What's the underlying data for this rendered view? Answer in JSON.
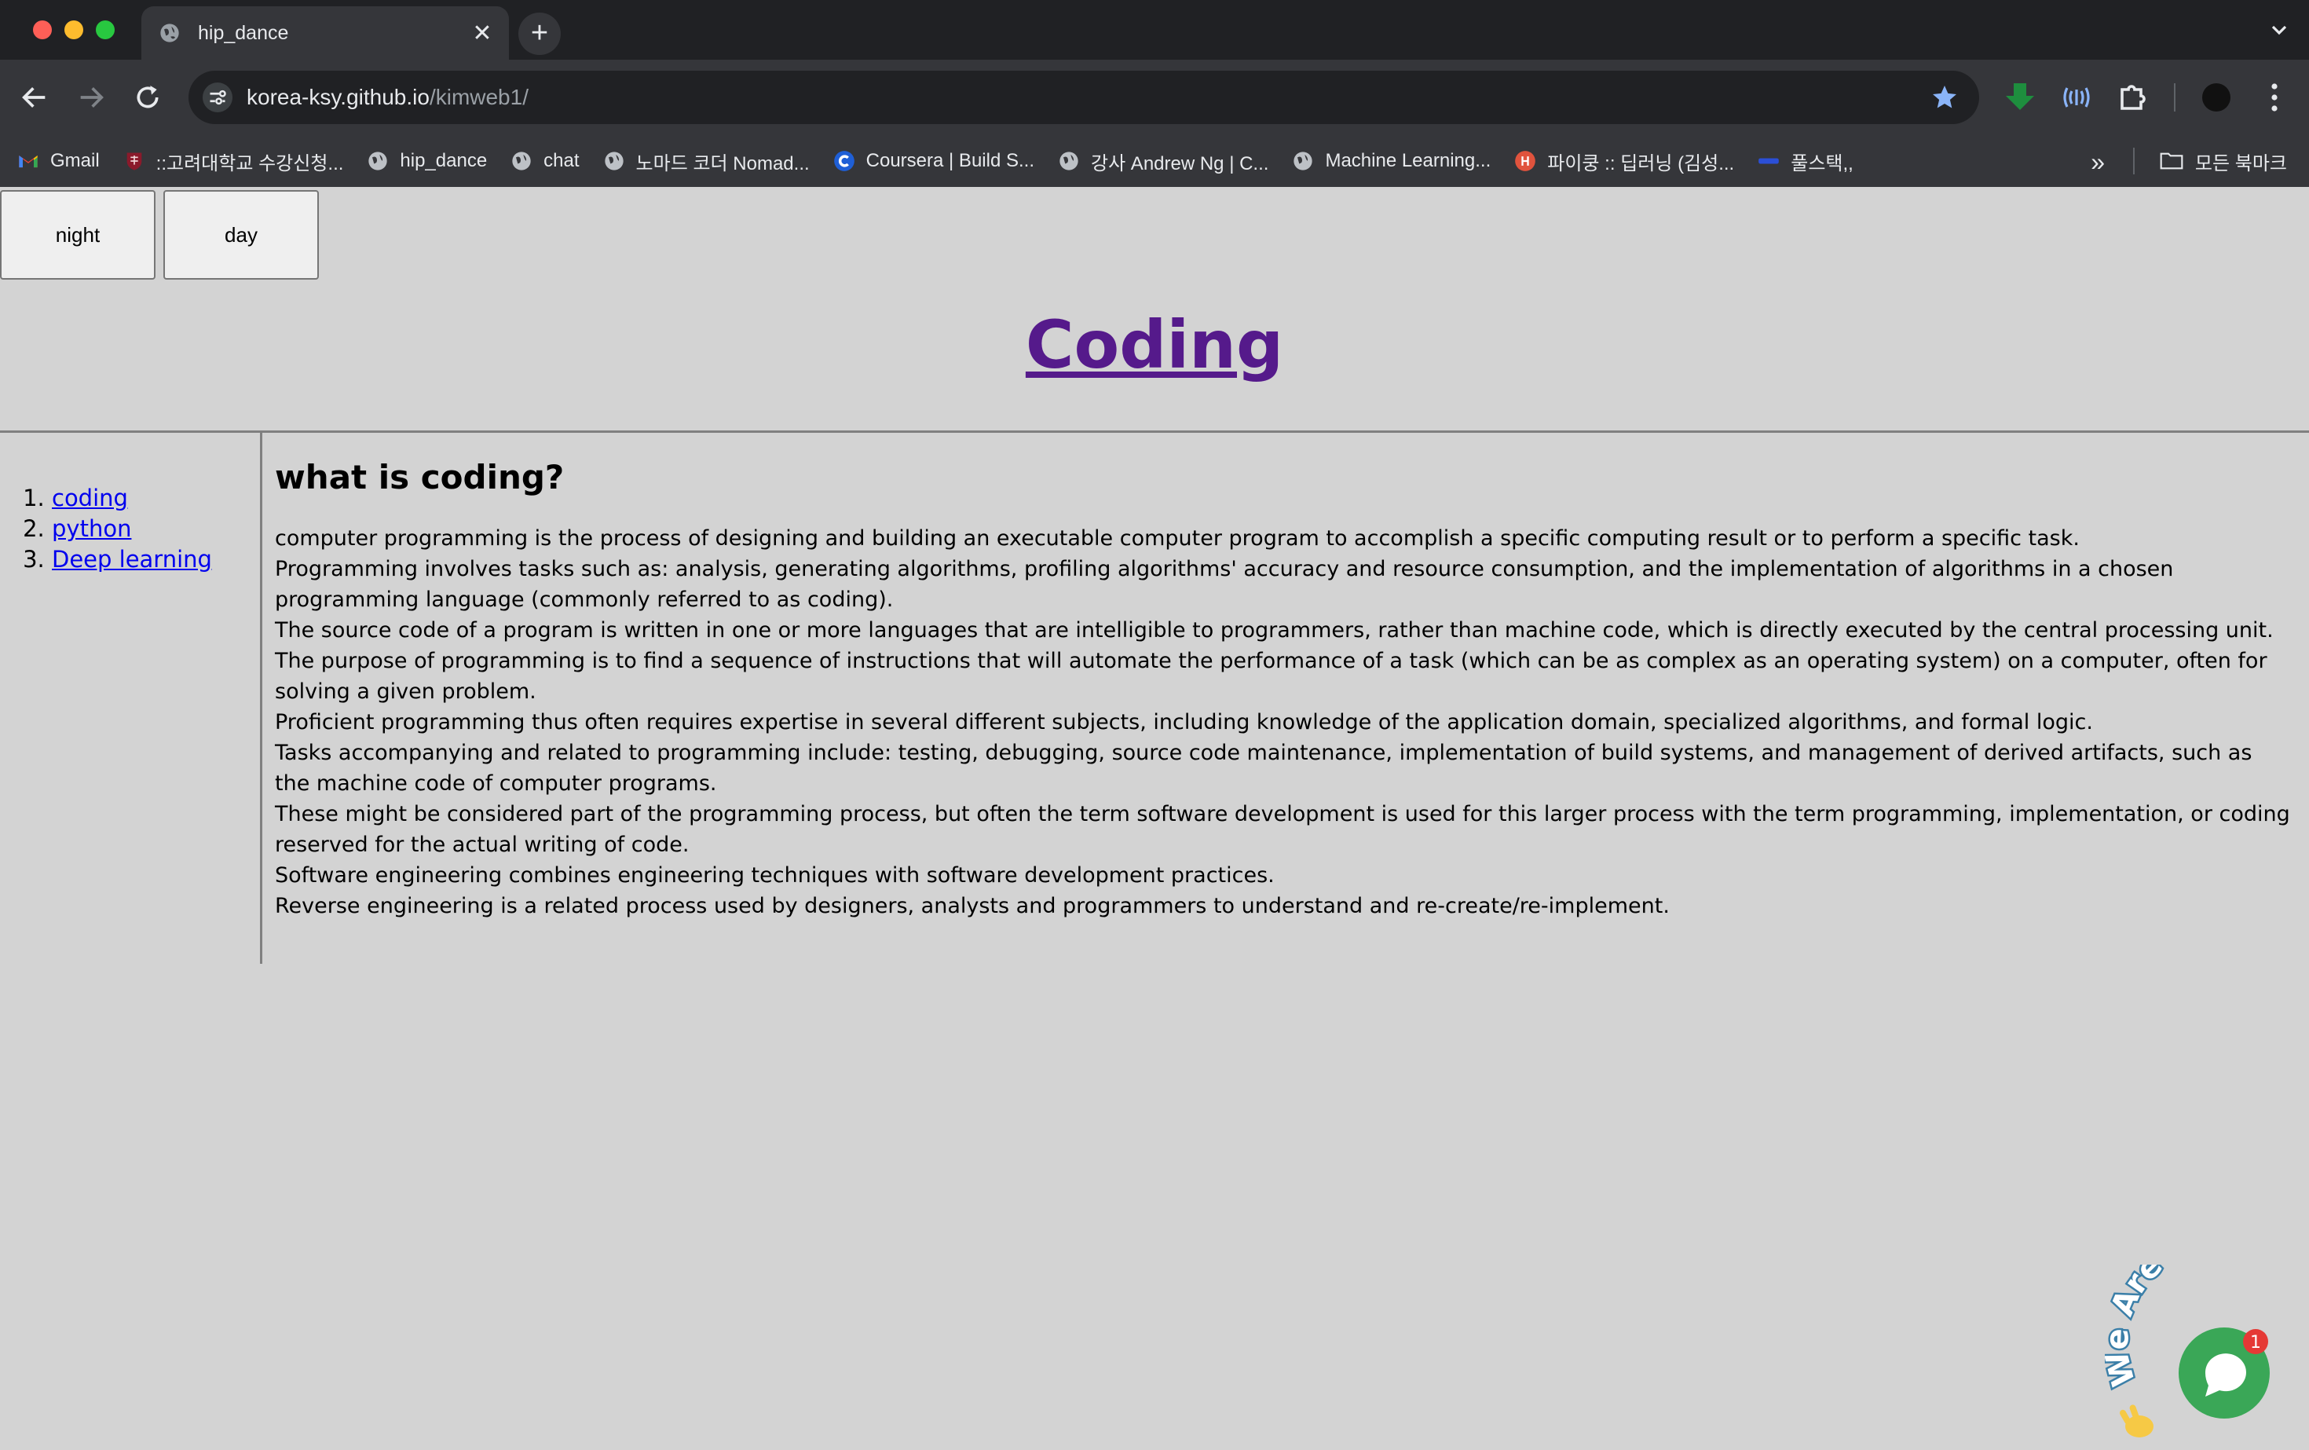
{
  "browser": {
    "tab_title": "hip_dance",
    "url_host": "korea-ksy.github.io",
    "url_path": "/kimweb1/",
    "new_tab_label": "+",
    "bookmarks": [
      {
        "label": "Gmail",
        "icon": "gmail-icon"
      },
      {
        "label": "::고려대학교 수강신청...",
        "icon": "university-shield-icon"
      },
      {
        "label": "hip_dance",
        "icon": "globe-icon"
      },
      {
        "label": "chat",
        "icon": "globe-icon"
      },
      {
        "label": "노마드 코더 Nomad...",
        "icon": "globe-icon"
      },
      {
        "label": "Coursera | Build S...",
        "icon": "coursera-icon"
      },
      {
        "label": "강사 Andrew Ng | C...",
        "icon": "globe-icon"
      },
      {
        "label": "Machine Learning...",
        "icon": "globe-icon"
      },
      {
        "label": "파이쿵 :: 딥러닝 (김성...",
        "icon": "pycoong-icon"
      },
      {
        "label": "풀스택,,",
        "icon": "fullstack-icon"
      }
    ],
    "more_bookmarks": "»",
    "all_bookmarks": "모든 북마크"
  },
  "page": {
    "buttons": {
      "night": "night",
      "day": "day"
    },
    "title": "Coding",
    "nav": [
      "coding",
      "python",
      "Deep learning"
    ],
    "heading": "what is coding?",
    "body": "computer programming is the process of designing and building an executable computer program to accomplish a specific computing result or to perform a specific task.\nProgramming involves tasks such as: analysis, generating algorithms, profiling algorithms' accuracy and resource consumption, and the implementation of algorithms in a chosen programming language (commonly referred to as coding).\nThe source code of a program is written in one or more languages that are intelligible to programmers, rather than machine code, which is directly executed by the central processing unit.\nThe purpose of programming is to find a sequence of instructions that will automate the performance of a task (which can be as complex as an operating system) on a computer, often for solving a given problem.\nProficient programming thus often requires expertise in several different subjects, including knowledge of the application domain, specialized algorithms, and formal logic.\nTasks accompanying and related to programming include: testing, debugging, source code maintenance, implementation of build systems, and management of derived artifacts, such as the machine code of computer programs.\nThese might be considered part of the programming process, but often the term software development is used for this larger process with the term programming, implementation, or coding reserved for the actual writing of code.\nSoftware engineering combines engineering techniques with software development practices.\nReverse engineering is a related process used by designers, analysts and programmers to understand and re-create/re-implement."
  },
  "chat_widget": {
    "caption": "We Are Here!",
    "badge_count": "1"
  },
  "colors": {
    "page_bg": "#d3d3d3",
    "title_link": "#551a8b",
    "nav_link": "#0000ee",
    "chat_green": "#3aa757",
    "badge_red": "#e53935"
  }
}
